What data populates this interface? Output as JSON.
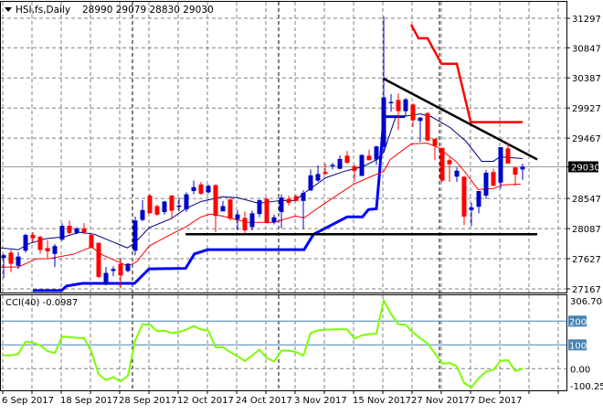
{
  "header": {
    "symbol_label": "HSI,fs,Daily",
    "ohlc_label": "28990 29079 28830 29030",
    "menu_icon": "triangle-down-icon"
  },
  "colors": {
    "bull_candle": "#0000c8",
    "bear_candle": "#ff0000",
    "ma_fast": "#000080",
    "ma_slow": "#ff0000",
    "channel_lower": "#0000ff",
    "channel_upper": "#ff0000",
    "trendline": "#000000",
    "cci_line": "#7cfc00",
    "cci_levels": "#4682b4",
    "grid": "#808080",
    "price_badge_bg": "#000000"
  },
  "chart_data": [
    {
      "type": "candlestick",
      "title": "HSI,fs,Daily",
      "ylim": [
        27167,
        31297
      ],
      "grid": true,
      "y_ticks": [
        31297,
        30847,
        30387,
        29927,
        29467,
        29030,
        28547,
        28087,
        27627,
        27167
      ],
      "y_tick_labels": [
        "31297",
        "30847",
        "30387",
        "29927",
        "29467",
        "29030",
        "28547",
        "28087",
        "27627",
        "27167"
      ],
      "current_price": 29030,
      "current_price_label": "29030",
      "x_tick_labels": [
        "6 Sep 2017",
        "18 Sep 2017",
        "28 Sep 2017",
        "12 Oct 2017",
        "24 Oct 2017",
        "3 Nov 2017",
        "15 Nov 2017",
        "27 Nov 2017",
        "7 Dec 2017"
      ],
      "x_tick_bars": [
        0,
        8,
        16,
        24,
        32,
        40,
        48,
        56,
        64
      ],
      "month_separator_bars": [
        18,
        38,
        60
      ],
      "ohlc": [
        [
          27640,
          27700,
          27334,
          27680
        ],
        [
          27720,
          27760,
          27420,
          27550
        ],
        [
          27520,
          27730,
          27470,
          27660
        ],
        [
          27750,
          28010,
          27720,
          27990
        ],
        [
          27990,
          28030,
          27880,
          27940
        ],
        [
          27960,
          27980,
          27700,
          27760
        ],
        [
          27790,
          27910,
          27640,
          27740
        ],
        [
          27700,
          27850,
          27500,
          27820
        ],
        [
          27920,
          28170,
          27900,
          28130
        ],
        [
          28130,
          28210,
          27980,
          28020
        ],
        [
          28020,
          28110,
          28000,
          28090
        ],
        [
          28090,
          28170,
          28000,
          28030
        ],
        [
          27990,
          28010,
          27790,
          27790
        ],
        [
          27870,
          27870,
          27330,
          27350
        ],
        [
          27230,
          27500,
          27220,
          27410
        ],
        [
          27440,
          27510,
          27360,
          27470
        ],
        [
          27550,
          27640,
          27170,
          27370
        ],
        [
          27440,
          27560,
          27420,
          27550
        ],
        [
          27750,
          28270,
          27680,
          28210
        ],
        [
          28220,
          28520,
          28200,
          28370
        ],
        [
          28590,
          28610,
          28320,
          28320
        ],
        [
          28430,
          28450,
          28280,
          28300
        ],
        [
          28340,
          28510,
          28300,
          28500
        ],
        [
          28590,
          28600,
          28230,
          28360
        ],
        [
          28420,
          28560,
          28350,
          28440
        ],
        [
          28380,
          28640,
          28340,
          28610
        ],
        [
          28660,
          28820,
          28610,
          28720
        ],
        [
          28760,
          28800,
          28600,
          28620
        ],
        [
          28640,
          28760,
          28620,
          28740
        ],
        [
          28750,
          28760,
          28030,
          28280
        ],
        [
          28350,
          28510,
          28350,
          28430
        ],
        [
          28530,
          28560,
          28210,
          28240
        ],
        [
          28230,
          28370,
          28060,
          28300
        ],
        [
          28250,
          28350,
          28010,
          28060
        ],
        [
          28110,
          28360,
          28060,
          28320
        ],
        [
          28310,
          28530,
          28260,
          28520
        ],
        [
          28540,
          28560,
          28170,
          28170
        ],
        [
          28180,
          28300,
          28150,
          28260
        ],
        [
          28340,
          28610,
          28090,
          28560
        ],
        [
          28540,
          28590,
          28440,
          28480
        ],
        [
          28580,
          28600,
          28500,
          28510
        ],
        [
          28510,
          28670,
          28080,
          28630
        ],
        [
          28670,
          28990,
          28660,
          28900
        ],
        [
          28820,
          29050,
          28800,
          28920
        ],
        [
          28950,
          29080,
          28910,
          28920
        ],
        [
          29050,
          29090,
          28990,
          29060
        ],
        [
          29000,
          29200,
          28990,
          29150
        ],
        [
          29200,
          29270,
          29080,
          29090
        ],
        [
          29040,
          29060,
          28810,
          28970
        ],
        [
          28890,
          29220,
          28890,
          29210
        ],
        [
          29200,
          29290,
          29130,
          29130
        ],
        [
          29140,
          29350,
          29060,
          29340
        ],
        [
          29330,
          31320,
          29250,
          30090
        ],
        [
          30010,
          30140,
          29870,
          30020
        ],
        [
          30050,
          30150,
          29590,
          29880
        ],
        [
          29880,
          30080,
          29800,
          30060
        ],
        [
          29980,
          30000,
          29640,
          29740
        ],
        [
          29730,
          29790,
          29410,
          29780
        ],
        [
          29850,
          29860,
          29430,
          29430
        ],
        [
          29460,
          29460,
          29130,
          29350
        ],
        [
          29320,
          29320,
          28800,
          28820
        ],
        [
          29130,
          29170,
          28800,
          29070
        ],
        [
          28880,
          29020,
          28800,
          28970
        ],
        [
          28880,
          28880,
          28140,
          28270
        ],
        [
          28370,
          28480,
          28130,
          28410
        ],
        [
          28420,
          28660,
          28320,
          28660
        ],
        [
          28590,
          28980,
          28540,
          28940
        ],
        [
          28950,
          29000,
          28740,
          28740
        ],
        [
          28790,
          29330,
          28700,
          29330
        ],
        [
          29310,
          29400,
          29080,
          29080
        ],
        [
          29020,
          29020,
          28740,
          28910
        ],
        [
          28990,
          29079,
          28830,
          29030
        ]
      ],
      "overlays": {
        "ma_fast": [
          [
            -0.5,
            27793
          ],
          [
            2,
            27765
          ],
          [
            3.6,
            27862
          ],
          [
            5.75,
            27932
          ],
          [
            8.25,
            27960
          ],
          [
            10.4,
            28030
          ],
          [
            12.4,
            28000
          ],
          [
            14.5,
            27904
          ],
          [
            16.9,
            27793
          ],
          [
            17.9,
            27862
          ],
          [
            19.9,
            28100
          ],
          [
            22.9,
            28238
          ],
          [
            24.9,
            28390
          ],
          [
            27,
            28500
          ],
          [
            29.9,
            28572
          ],
          [
            32,
            28558
          ],
          [
            34.9,
            28474
          ],
          [
            37.9,
            28516
          ],
          [
            39.9,
            28516
          ],
          [
            41.1,
            28627
          ],
          [
            44.1,
            28864
          ],
          [
            46.6,
            28961
          ],
          [
            49.1,
            29030
          ],
          [
            51.1,
            29142
          ],
          [
            52,
            29250
          ],
          [
            52.9,
            29550
          ],
          [
            53.6,
            29780
          ],
          [
            57,
            29837
          ],
          [
            58.5,
            29795
          ],
          [
            61.1,
            29628
          ],
          [
            63.25,
            29420
          ],
          [
            65.4,
            29114
          ],
          [
            67,
            29114
          ],
          [
            67.9,
            29183
          ],
          [
            71,
            29155
          ]
        ],
        "ma_slow": [
          [
            -0.5,
            27500
          ],
          [
            2,
            27500
          ],
          [
            4.5,
            27626
          ],
          [
            6.1,
            27626
          ],
          [
            9.5,
            27695
          ],
          [
            12,
            27806
          ],
          [
            13.6,
            27681
          ],
          [
            17,
            27515
          ],
          [
            18.25,
            27584
          ],
          [
            19.9,
            27820
          ],
          [
            22.9,
            28000
          ],
          [
            24.9,
            28112
          ],
          [
            27,
            28265
          ],
          [
            28.25,
            28307
          ],
          [
            29.9,
            28280
          ],
          [
            33.25,
            28182
          ],
          [
            37,
            28182
          ],
          [
            39.9,
            28280
          ],
          [
            41.1,
            28252
          ],
          [
            43.6,
            28446
          ],
          [
            47.9,
            28766
          ],
          [
            49.9,
            28864
          ],
          [
            52,
            28961
          ],
          [
            52.9,
            29142
          ],
          [
            55.75,
            29378
          ],
          [
            57.9,
            29392
          ],
          [
            59.5,
            29322
          ],
          [
            62,
            29100
          ],
          [
            63.25,
            28933
          ],
          [
            64.9,
            28683
          ],
          [
            67,
            28697
          ],
          [
            68.25,
            28753
          ],
          [
            70.75,
            28766
          ]
        ],
        "channel_lower": [
          [
            4,
            27140
          ],
          [
            7.9,
            27140
          ],
          [
            8.6,
            27210
          ],
          [
            10.75,
            27250
          ],
          [
            17.9,
            27250
          ],
          [
            19.9,
            27473
          ],
          [
            24.9,
            27480
          ],
          [
            26.1,
            27700
          ],
          [
            27.9,
            27765
          ],
          [
            41.1,
            27765
          ],
          [
            42.4,
            28000
          ],
          [
            44.1,
            28098
          ],
          [
            47,
            28265
          ],
          [
            49.1,
            28265
          ],
          [
            49.9,
            28377
          ],
          [
            51,
            28390
          ],
          [
            51.4,
            28900
          ],
          [
            52,
            29795
          ],
          [
            54.9,
            29795
          ]
        ],
        "channel_upper": [
          [
            55.75,
            31200
          ],
          [
            56.75,
            30991
          ],
          [
            58,
            30991
          ],
          [
            59.9,
            30602
          ],
          [
            62,
            30602
          ],
          [
            63.9,
            29712
          ],
          [
            71,
            29712
          ]
        ],
        "trendline_down": [
          [
            51.9,
            30379
          ],
          [
            73,
            29142
          ]
        ],
        "horizontal_support": [
          [
            24.9,
            28000
          ],
          [
            73,
            28000
          ]
        ]
      }
    },
    {
      "type": "line",
      "title": "CCI(40) -0.0987",
      "ylim": [
        -100.258,
        306.7083
      ],
      "levels": [
        200,
        100
      ],
      "zero_line": 0,
      "y_tick_labels": [
        "306.7083",
        "200",
        "100",
        "0.00",
        "-100.258"
      ],
      "values": [
        56,
        56,
        62,
        114,
        110,
        98,
        74,
        66,
        135,
        133,
        130,
        128,
        72,
        -24,
        -48,
        -36,
        -54,
        -30,
        118,
        187,
        185,
        158,
        160,
        150,
        154,
        165,
        179,
        165,
        160,
        90,
        90,
        70,
        52,
        32,
        55,
        80,
        45,
        30,
        76,
        76,
        70,
        55,
        150,
        161,
        164,
        165,
        166,
        165,
        126,
        140,
        145,
        148,
        287,
        230,
        187,
        185,
        152,
        128,
        106,
        65,
        21,
        24,
        10,
        -60,
        -79,
        -40,
        -12,
        -5,
        33,
        36,
        -10,
        0
      ]
    }
  ]
}
